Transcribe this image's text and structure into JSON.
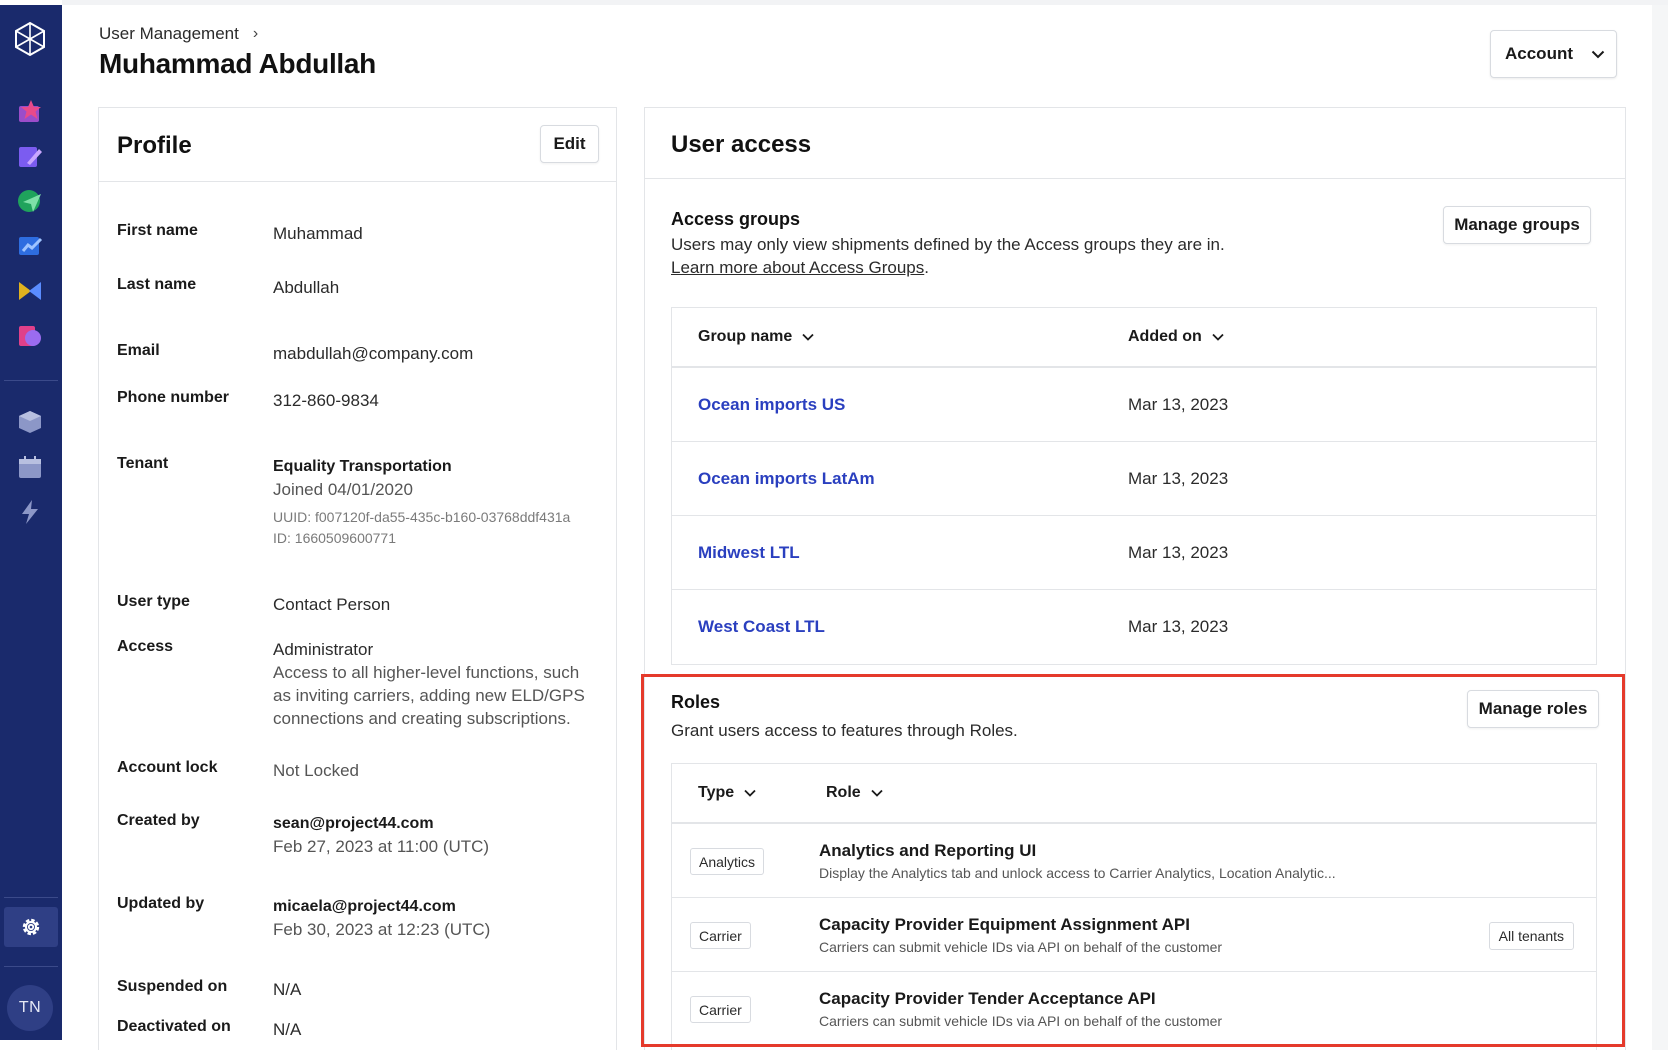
{
  "sidebar": {
    "avatar_initials": "TN",
    "icons": [
      "logo-icon",
      "shipments-icon",
      "notes-icon",
      "tracking-icon",
      "analytics-icon",
      "carriers-icon",
      "documents-icon",
      "inventory-icon",
      "calendar-icon",
      "automation-icon",
      "settings-icon"
    ]
  },
  "header": {
    "breadcrumb": "User Management",
    "breadcrumb_sep": "›",
    "title": "Muhammad Abdullah",
    "account_button": "Account"
  },
  "profile": {
    "title": "Profile",
    "edit_label": "Edit",
    "fields": {
      "first_name": {
        "label": "First name",
        "value": "Muhammad"
      },
      "last_name": {
        "label": "Last name",
        "value": "Abdullah"
      },
      "email": {
        "label": "Email",
        "value": "mabdullah@company.com"
      },
      "phone": {
        "label": "Phone number",
        "value": "312-860-9834"
      },
      "tenant": {
        "label": "Tenant",
        "name": "Equality Transportation",
        "joined": "Joined 04/01/2020",
        "uuid": "UUID: f007120f-da55-435c-b160-03768ddf431a",
        "id": "ID: 1660509600771"
      },
      "user_type": {
        "label": "User type",
        "value": "Contact Person"
      },
      "access": {
        "label": "Access",
        "value": "Administrator",
        "desc": "Access to all higher-level functions, such as inviting carriers, adding new ELD/GPS connections and creating subscriptions."
      },
      "account_lock": {
        "label": "Account lock",
        "value": "Not Locked"
      },
      "created_by": {
        "label": "Created by",
        "email": "sean@project44.com",
        "date": "Feb 27, 2023 at 11:00 (UTC)"
      },
      "updated_by": {
        "label": "Updated by",
        "email": "micaela@project44.com",
        "date": "Feb 30, 2023 at 12:23 (UTC)"
      },
      "suspended_on": {
        "label": "Suspended on",
        "value": "N/A"
      },
      "deactivated_on": {
        "label": "Deactivated on",
        "value": "N/A"
      }
    }
  },
  "user_access": {
    "title": "User access",
    "access_groups": {
      "title": "Access groups",
      "desc": "Users may only view shipments defined by the Access groups they are in.",
      "link": "Learn more about Access Groups",
      "link_suffix": ".",
      "manage_label": "Manage groups",
      "columns": [
        "Group name",
        "Added on"
      ],
      "rows": [
        {
          "name": "Ocean imports US",
          "date": "Mar 13, 2023"
        },
        {
          "name": "Ocean imports LatAm",
          "date": "Mar 13, 2023"
        },
        {
          "name": "Midwest LTL",
          "date": "Mar 13, 2023"
        },
        {
          "name": "West Coast LTL",
          "date": "Mar 13, 2023"
        }
      ]
    },
    "roles": {
      "title": "Roles",
      "desc": "Grant users access to features through Roles.",
      "manage_label": "Manage roles",
      "columns": [
        "Type",
        "Role"
      ],
      "rows": [
        {
          "type": "Analytics",
          "name": "Analytics and Reporting UI",
          "desc": "Display the Analytics tab and unlock access to Carrier Analytics, Location Analytic...",
          "scope": ""
        },
        {
          "type": "Carrier",
          "name": "Capacity Provider Equipment Assignment API",
          "desc": "Carriers can submit vehicle IDs via API on behalf of the customer",
          "scope": "All tenants"
        },
        {
          "type": "Carrier",
          "name": "Capacity Provider Tender Acceptance API",
          "desc": "Carriers can submit vehicle IDs via API on behalf of the customer",
          "scope": ""
        }
      ]
    }
  },
  "colors": {
    "sidebar_bg": "#1a2a6c",
    "link": "#2a3fbf",
    "highlight": "#e53a2b"
  }
}
